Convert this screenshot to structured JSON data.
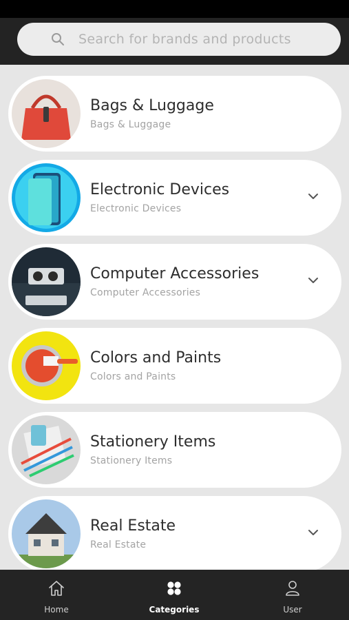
{
  "search": {
    "placeholder": "Search for brands and products"
  },
  "categories": [
    {
      "title": "Bags & Luggage",
      "subtitle": "Bags & Luggage",
      "expandable": false
    },
    {
      "title": "Electronic Devices",
      "subtitle": "Electronic Devices",
      "expandable": true
    },
    {
      "title": "Computer Accessories",
      "subtitle": "Computer Accessories",
      "expandable": true
    },
    {
      "title": "Colors and Paints",
      "subtitle": "Colors and Paints",
      "expandable": false
    },
    {
      "title": "Stationery Items",
      "subtitle": "Stationery Items",
      "expandable": false
    },
    {
      "title": "Real Estate",
      "subtitle": "Real Estate",
      "expandable": true
    }
  ],
  "nav": [
    {
      "label": "Home",
      "icon": "home-icon",
      "active": false
    },
    {
      "label": "Categories",
      "icon": "grid-icon",
      "active": true
    },
    {
      "label": "User",
      "icon": "user-icon",
      "active": false
    }
  ],
  "colors": {
    "header": "#232323",
    "background": "#e6e6e6",
    "nav": "#242424",
    "card": "#ffffff"
  }
}
